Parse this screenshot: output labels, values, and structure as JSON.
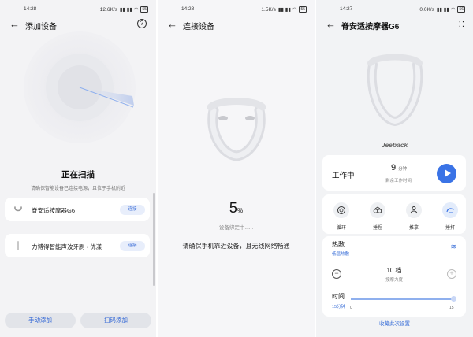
{
  "screen1": {
    "status": {
      "time": "14:28",
      "net": "12.6K/s",
      "battery": "55"
    },
    "back_icon": "back-arrow-icon",
    "title": "添加设备",
    "help_icon": "question-icon",
    "scanning_text": "正在扫描",
    "hint_text": "请确保智能设备已连接电源，且位于手机附近",
    "devices": [
      {
        "name": "脊安适按摩器G6",
        "button": "连接"
      },
      {
        "name": "力博得智能声波牙刷 · 优漾",
        "button": "连接"
      }
    ],
    "manual_add": "手动添加",
    "scan_add": "扫码添加"
  },
  "screen2": {
    "status": {
      "time": "14:28",
      "net": "1.5K/s",
      "battery": "55"
    },
    "title": "连接设备",
    "percent_value": "5",
    "percent_unit": "%",
    "binding_text": "设备绑定中......",
    "keep_close_text": "请确保手机靠近设备，且无线网络畅通"
  },
  "screen3": {
    "status": {
      "time": "14:27",
      "net": "0.0K/s",
      "battery": "56"
    },
    "title": "脊安适按摩器G6",
    "brand": "Jeeback",
    "work_label": "工作中",
    "minutes_value": "9",
    "minutes_unit": "分钟",
    "remaining_label": "剩余工作时间",
    "modes": [
      {
        "label": "循环",
        "icon": "cycle-icon"
      },
      {
        "label": "捶捏",
        "icon": "knead-icon"
      },
      {
        "label": "推拿",
        "icon": "massage-icon"
      },
      {
        "label": "捶打",
        "icon": "tap-icon"
      }
    ],
    "heat_label": "热敷",
    "heat_sub": "低温热敷",
    "intensity_value": "10 档",
    "intensity_sub": "按摩力度",
    "time_label": "时间",
    "time_sub": "15分钟",
    "time_slider_fraction": 1.0,
    "slider_min": "0",
    "slider_max": "15",
    "collect_text": "收藏此次设置"
  },
  "colors": {
    "accent": "#3a73e6",
    "link": "#3569d6"
  }
}
